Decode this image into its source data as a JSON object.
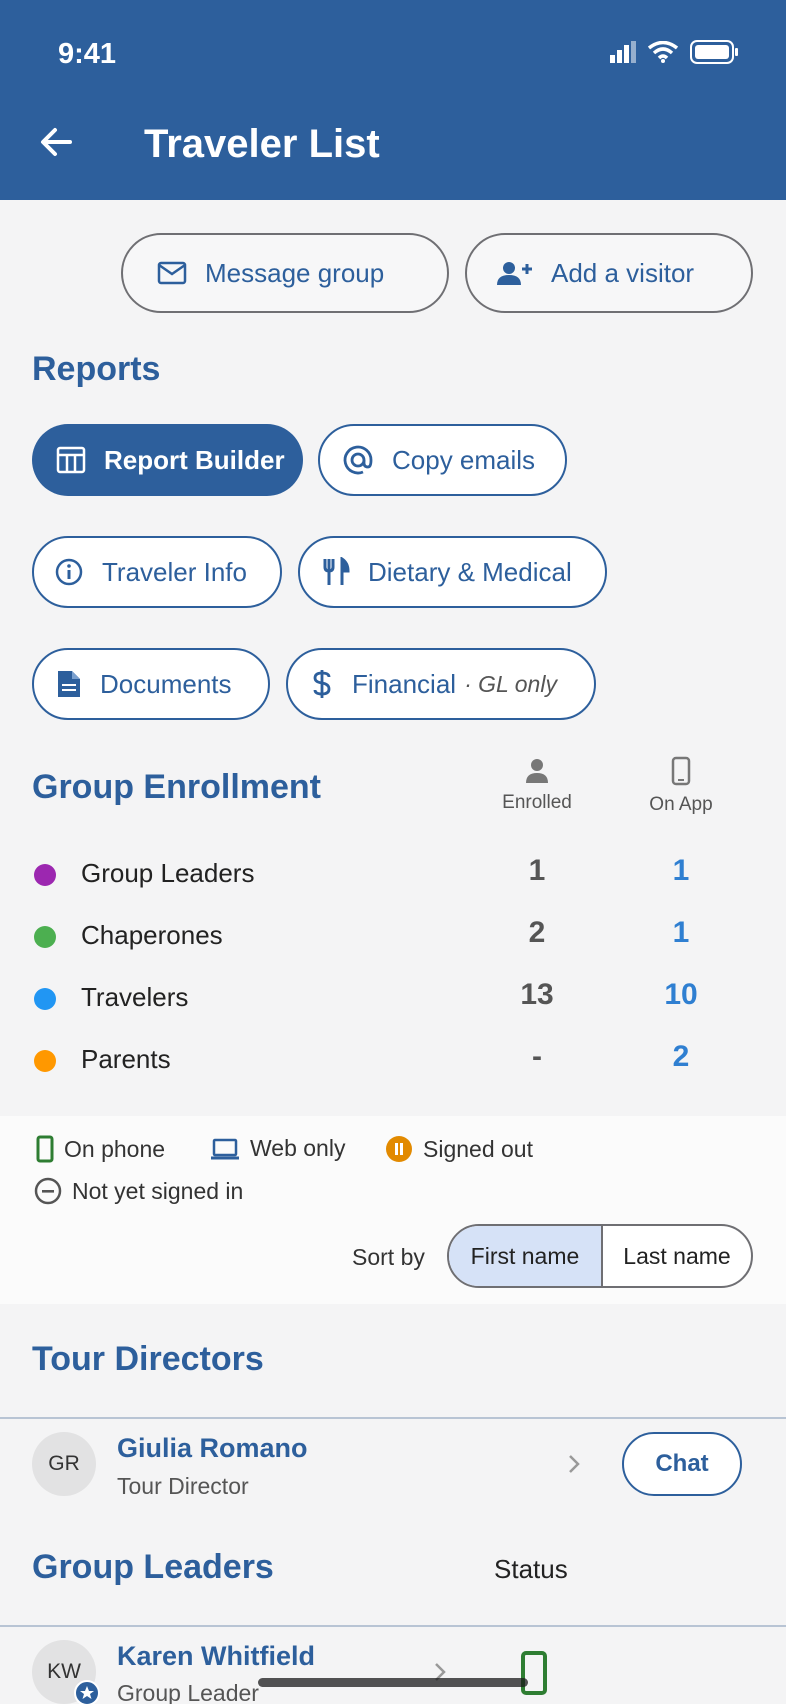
{
  "status_bar": {
    "time": "9:41"
  },
  "header": {
    "title": "Traveler List"
  },
  "actions": {
    "message_group": "Message group",
    "add_visitor": "Add a visitor"
  },
  "reports": {
    "heading": "Reports",
    "report_builder": "Report Builder",
    "copy_emails": "Copy emails",
    "traveler_info": "Traveler Info",
    "dietary_medical": "Dietary & Medical",
    "documents": "Documents",
    "financial": "Financial",
    "financial_note": "· GL only"
  },
  "enrollment": {
    "heading": "Group Enrollment",
    "col_enrolled": "Enrolled",
    "col_on_app": "On App",
    "rows": [
      {
        "label": "Group Leaders",
        "enrolled": "1",
        "on_app": "1",
        "color": "#9c27b0"
      },
      {
        "label": "Chaperones",
        "enrolled": "2",
        "on_app": "1",
        "color": "#4caf50"
      },
      {
        "label": "Travelers",
        "enrolled": "13",
        "on_app": "10",
        "color": "#2196f3"
      },
      {
        "label": "Parents",
        "enrolled": "-",
        "on_app": "2",
        "color": "#ff9800"
      }
    ]
  },
  "legend": {
    "on_phone": "On phone",
    "web_only": "Web only",
    "signed_out": "Signed out",
    "not_signed_in": "Not yet signed in"
  },
  "sort": {
    "label": "Sort by",
    "first_name": "First name",
    "last_name": "Last name",
    "selected": "First name"
  },
  "tour_directors": {
    "heading": "Tour Directors",
    "people": [
      {
        "initials": "GR",
        "name": "Giulia Romano",
        "role": "Tour Director",
        "action": "Chat"
      }
    ]
  },
  "group_leaders": {
    "heading": "Group Leaders",
    "status_label": "Status",
    "people": [
      {
        "initials": "KW",
        "name": "Karen Whitfield",
        "role": "Group Leader"
      }
    ]
  },
  "colors": {
    "brand": "#2d5f9c",
    "accent_blue": "#2f7fd1",
    "phone_green": "#2e7d32",
    "signed_out_orange": "#e28a00"
  }
}
